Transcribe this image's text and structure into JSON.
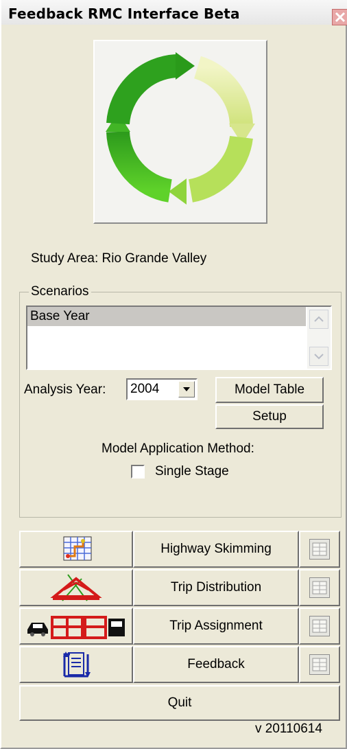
{
  "window": {
    "title": "Feedback RMC Interface Beta"
  },
  "study_area": "Study Area: Rio Grande Valley",
  "scenarios": {
    "legend": "Scenarios",
    "items": [
      "Base Year"
    ]
  },
  "analysis_year": {
    "label": "Analysis Year:",
    "value": "2004"
  },
  "buttons": {
    "model_table": "Model Table",
    "setup": "Setup",
    "quit": "Quit"
  },
  "method": {
    "label": "Model Application Method:",
    "single_stage": "Single Stage",
    "single_stage_checked": false
  },
  "steps": [
    {
      "label": "Highway Skimming",
      "icon": "highway-network-icon"
    },
    {
      "label": "Trip Distribution",
      "icon": "trip-distribution-icon"
    },
    {
      "label": "Trip Assignment",
      "icon": "trip-assignment-icon"
    },
    {
      "label": "Feedback",
      "icon": "feedback-loop-icon"
    }
  ],
  "version": "v 20110614",
  "colors": {
    "arrow_green": "#2e9c1e",
    "arrow_light": "#e8f0a0",
    "close_red": "#d9534f"
  }
}
